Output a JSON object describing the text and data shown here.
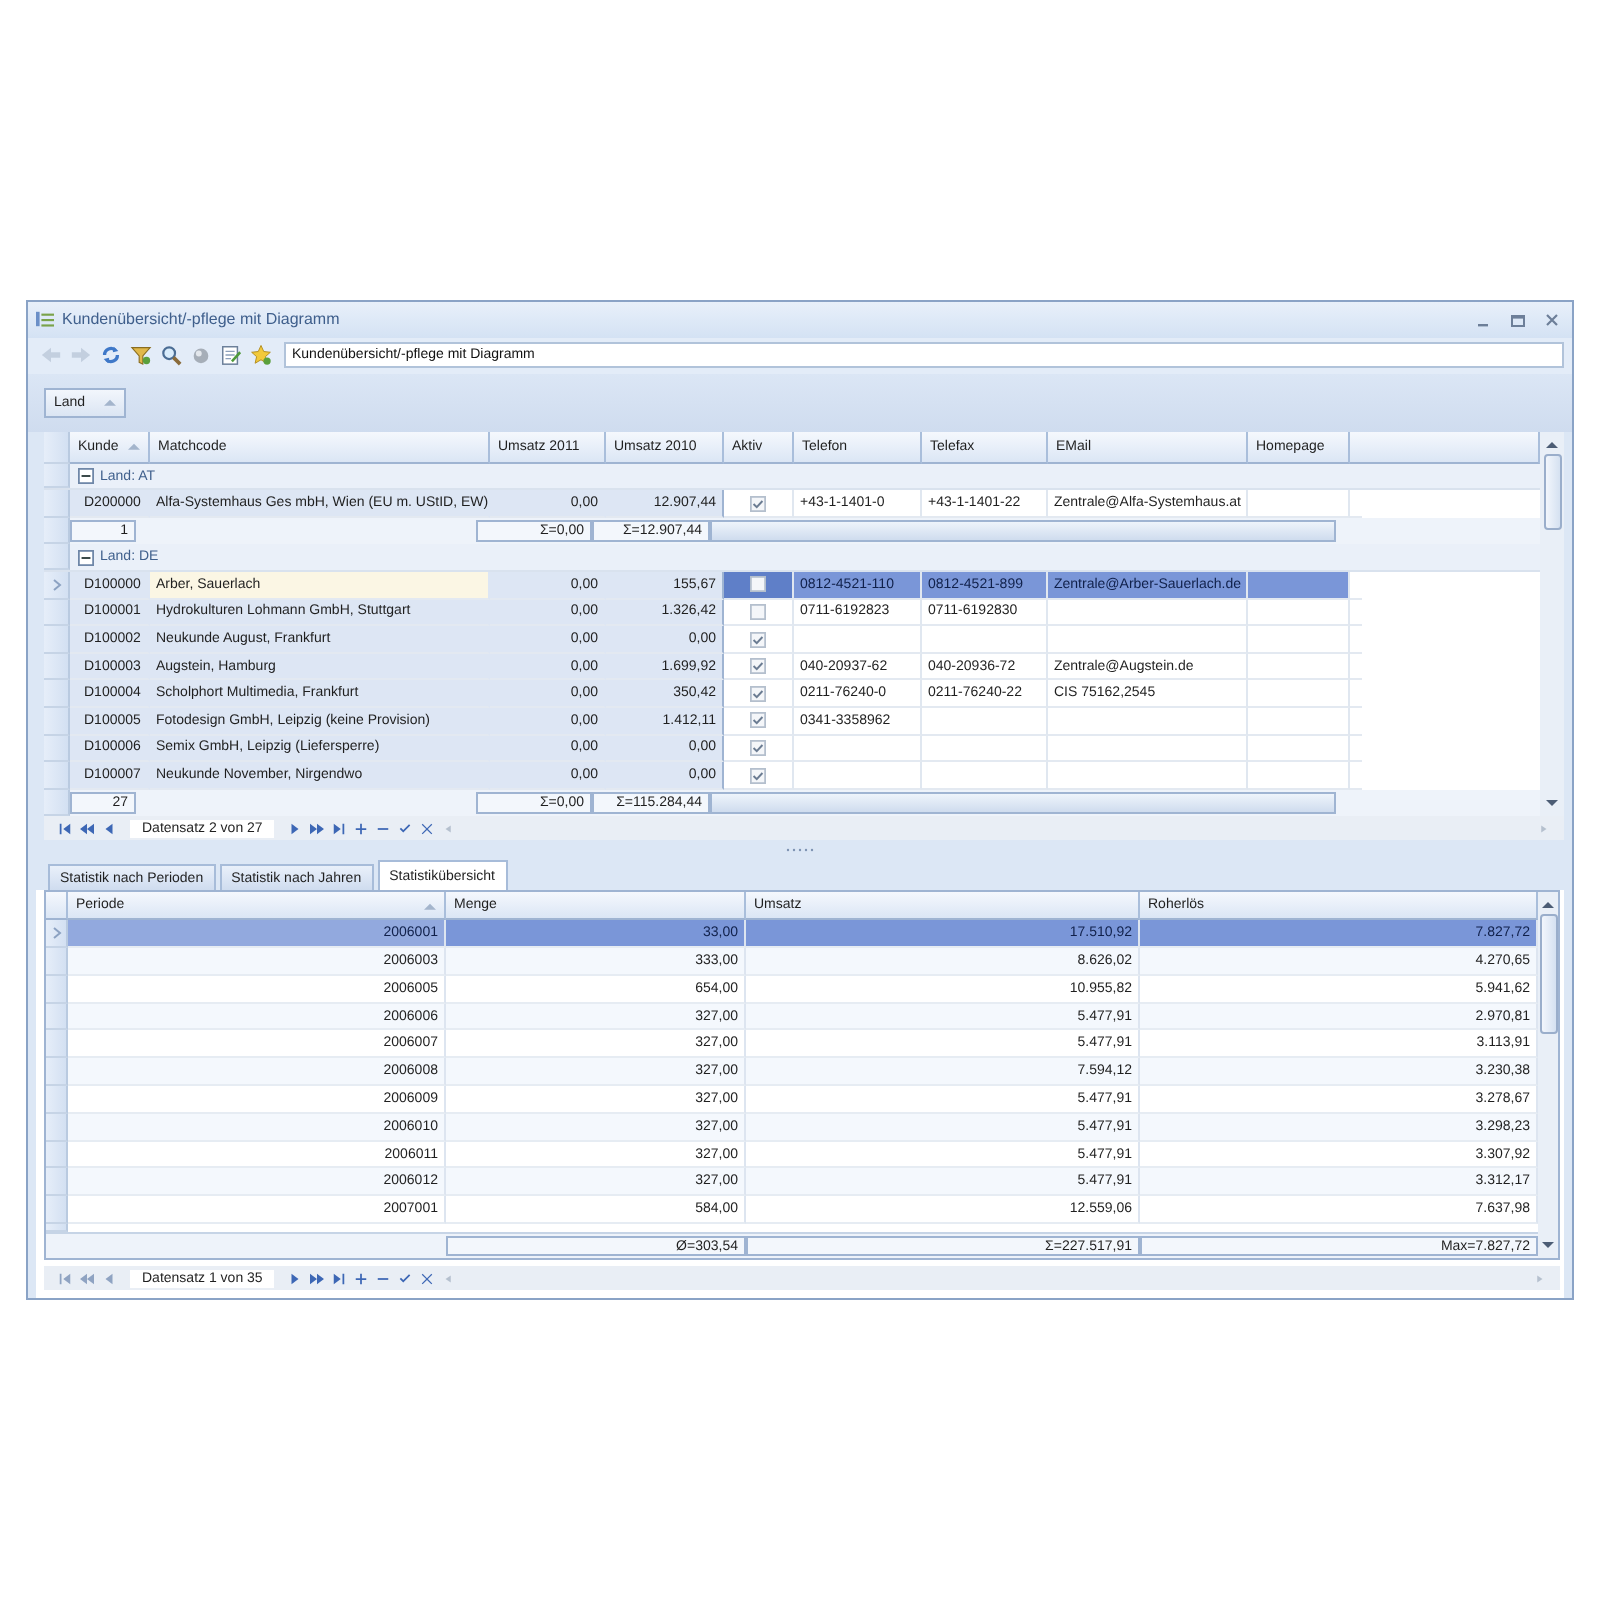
{
  "window": {
    "title": "Kundenübersicht/-pflege mit Diagramm"
  },
  "toolbar": {
    "address": "Kundenübersicht/-pflege mit Diagramm"
  },
  "group_panel": {
    "group_by": "Land"
  },
  "customers": {
    "columns": [
      {
        "label": "Kunde",
        "sorted": true
      },
      {
        "label": "Matchcode",
        "sorted": false
      },
      {
        "label": "Umsatz 2011",
        "sorted": false
      },
      {
        "label": "Umsatz 2010",
        "sorted": false
      },
      {
        "label": "Aktiv",
        "sorted": false
      },
      {
        "label": "Telefon",
        "sorted": false
      },
      {
        "label": "Telefax",
        "sorted": false
      },
      {
        "label": "EMail",
        "sorted": false
      },
      {
        "label": "Homepage",
        "sorted": false
      }
    ],
    "groups": [
      {
        "label": "Land: AT",
        "expanded": true,
        "rows": [
          {
            "kunde": "D200000",
            "matchcode": "Alfa-Systemhaus Ges mbH, Wien (EU m. UStID, EW)",
            "umsatz_2011": "0,00",
            "umsatz_2010": "12.907,44",
            "aktiv": true,
            "telefon": "+43-1-1401-0",
            "telefax": "+43-1-1401-22",
            "email": "Zentrale@Alfa-Systemhaus.at",
            "selected": false
          }
        ],
        "footer": {
          "count": "1",
          "umsatz_2011": "Σ=0,00",
          "umsatz_2010": "Σ=12.907,44"
        }
      },
      {
        "label": "Land: DE",
        "expanded": true,
        "rows": [
          {
            "kunde": "D100000",
            "matchcode": "Arber, Sauerlach",
            "umsatz_2011": "0,00",
            "umsatz_2010": "155,67",
            "aktiv": false,
            "telefon": "0812-4521-110",
            "telefax": "0812-4521-899",
            "email": "Zentrale@Arber-Sauerlach.de",
            "selected": true
          },
          {
            "kunde": "D100001",
            "matchcode": "Hydrokulturen Lohmann GmbH, Stuttgart",
            "umsatz_2011": "0,00",
            "umsatz_2010": "1.326,42",
            "aktiv": false,
            "telefon": "0711-6192823",
            "telefax": "0711-6192830",
            "selected": false
          },
          {
            "kunde": "D100002",
            "matchcode": "Neukunde August, Frankfurt",
            "umsatz_2011": "0,00",
            "umsatz_2010": "0,00",
            "aktiv": true,
            "selected": false
          },
          {
            "kunde": "D100003",
            "matchcode": "Augstein, Hamburg",
            "umsatz_2011": "0,00",
            "umsatz_2010": "1.699,92",
            "aktiv": true,
            "telefon": "040-20937-62",
            "telefax": "040-20936-72",
            "email": "Zentrale@Augstein.de",
            "selected": false
          },
          {
            "kunde": "D100004",
            "matchcode": "Scholphort Multimedia, Frankfurt",
            "umsatz_2011": "0,00",
            "umsatz_2010": "350,42",
            "aktiv": true,
            "telefon": "0211-76240-0",
            "telefax": "0211-76240-22",
            "email": "CIS 75162,2545",
            "selected": false
          },
          {
            "kunde": "D100005",
            "matchcode": "Fotodesign GmbH, Leipzig  (keine Provision)",
            "umsatz_2011": "0,00",
            "umsatz_2010": "1.412,11",
            "aktiv": true,
            "telefon": "0341-3358962",
            "selected": false
          },
          {
            "kunde": "D100006",
            "matchcode": "Semix GmbH, Leipzig (Liefersperre)",
            "umsatz_2011": "0,00",
            "umsatz_2010": "0,00",
            "aktiv": true,
            "selected": false
          },
          {
            "kunde": "D100007",
            "matchcode": "Neukunde November, Nirgendwo",
            "umsatz_2011": "0,00",
            "umsatz_2010": "0,00",
            "aktiv": true,
            "selected": false
          }
        ],
        "footer": {
          "count": "27",
          "umsatz_2011": "Σ=0,00",
          "umsatz_2010": "Σ=115.284,44"
        }
      }
    ],
    "navigator": {
      "text": "Datensatz 2 von 27"
    }
  },
  "tabs": [
    {
      "label": "Statistik nach Perioden",
      "selected": false
    },
    {
      "label": "Statistik nach Jahren",
      "selected": false
    },
    {
      "label": "Statistikübersicht",
      "selected": true
    }
  ],
  "statistics": {
    "columns": [
      {
        "label": "Periode",
        "sorted": true
      },
      {
        "label": "Menge",
        "sorted": false
      },
      {
        "label": "Umsatz",
        "sorted": false
      },
      {
        "label": "Roherlös",
        "sorted": false
      }
    ],
    "rows": [
      {
        "periode": "2006001",
        "menge": "33,00",
        "umsatz": "17.510,92",
        "roherloes": "7.827,72",
        "selected": true
      },
      {
        "periode": "2006003",
        "menge": "333,00",
        "umsatz": "8.626,02",
        "roherloes": "4.270,65",
        "selected": false
      },
      {
        "periode": "2006005",
        "menge": "654,00",
        "umsatz": "10.955,82",
        "roherloes": "5.941,62",
        "selected": false
      },
      {
        "periode": "2006006",
        "menge": "327,00",
        "umsatz": "5.477,91",
        "roherloes": "2.970,81",
        "selected": false
      },
      {
        "periode": "2006007",
        "menge": "327,00",
        "umsatz": "5.477,91",
        "roherloes": "3.113,91",
        "selected": false
      },
      {
        "periode": "2006008",
        "menge": "327,00",
        "umsatz": "7.594,12",
        "roherloes": "3.230,38",
        "selected": false
      },
      {
        "periode": "2006009",
        "menge": "327,00",
        "umsatz": "5.477,91",
        "roherloes": "3.278,67",
        "selected": false
      },
      {
        "periode": "2006010",
        "menge": "327,00",
        "umsatz": "5.477,91",
        "roherloes": "3.298,23",
        "selected": false
      },
      {
        "periode": "2006011",
        "menge": "327,00",
        "umsatz": "5.477,91",
        "roherloes": "3.307,92",
        "selected": false
      },
      {
        "periode": "2006012",
        "menge": "327,00",
        "umsatz": "5.477,91",
        "roherloes": "3.312,17",
        "selected": false
      },
      {
        "periode": "2007001",
        "menge": "584,00",
        "umsatz": "12.559,06",
        "roherloes": "7.637,98",
        "selected": false
      }
    ],
    "footer": {
      "menge": "Ø=303,54",
      "umsatz": "Σ=227.517,91",
      "roherloes": "Max=7.827,72"
    },
    "navigator": {
      "text": "Datensatz 1 von 35"
    }
  }
}
